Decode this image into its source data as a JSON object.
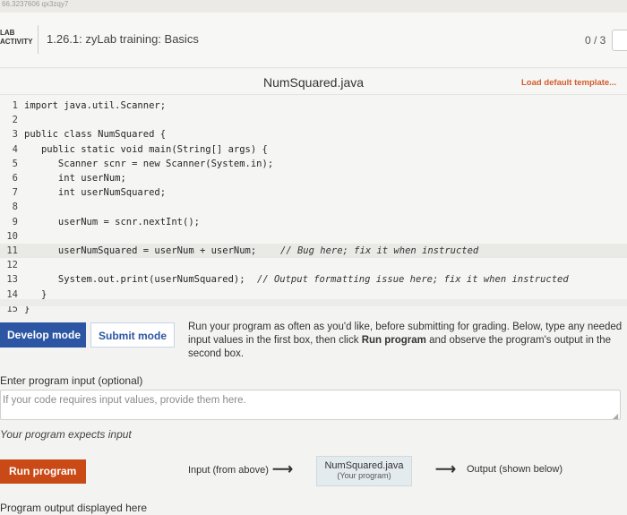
{
  "top_strip": {
    "text": "66.3237606 qx3zqy7"
  },
  "header": {
    "activity_label": "LAB\nACTIVITY",
    "title": "1.26.1: zyLab training: Basics",
    "score": "0 / 3"
  },
  "editor": {
    "file_name": "NumSquared.java",
    "load_template": "Load default template..."
  },
  "code_lines": [
    {
      "num": "1",
      "code": "import java.util.Scanner;",
      "comment": ""
    },
    {
      "num": "2",
      "code": "",
      "comment": ""
    },
    {
      "num": "3",
      "code": "public class NumSquared {",
      "comment": ""
    },
    {
      "num": "4",
      "code": "   public static void main(String[] args) {",
      "comment": ""
    },
    {
      "num": "5",
      "code": "      Scanner scnr = new Scanner(System.in);",
      "comment": ""
    },
    {
      "num": "6",
      "code": "      int userNum;",
      "comment": ""
    },
    {
      "num": "7",
      "code": "      int userNumSquared;",
      "comment": ""
    },
    {
      "num": "8",
      "code": "",
      "comment": ""
    },
    {
      "num": "9",
      "code": "      userNum = scnr.nextInt();",
      "comment": ""
    },
    {
      "num": "10",
      "code": "",
      "comment": ""
    },
    {
      "num": "11",
      "code": "      userNumSquared = userNum + userNum;",
      "comment": "// Bug here; fix it when instructed"
    },
    {
      "num": "12",
      "code": "",
      "comment": ""
    },
    {
      "num": "13",
      "code": "      System.out.print(userNumSquared);",
      "comment": "// Output formatting issue here; fix it when instructed"
    },
    {
      "num": "14",
      "code": "   }",
      "comment": ""
    },
    {
      "num": "15",
      "code": "}",
      "comment": ""
    }
  ],
  "modes": {
    "develop_label": "Develop mode",
    "submit_label": "Submit mode",
    "desc_part1": "Run your program as often as you'd like, before submitting for grading. Below, type any needed input values in the first box, then click ",
    "desc_bold": "Run program",
    "desc_part2": " and observe the program's output in the second box."
  },
  "input": {
    "label": "Enter program input (optional)",
    "placeholder": "If your code requires input values, provide them here."
  },
  "expects_text": "Your program expects input",
  "run": {
    "button_label": "Run program",
    "input_from": "Input (from above)",
    "program_name": "NumSquared.java",
    "program_sub": "(Your program)",
    "output_to": "Output (shown below)"
  },
  "output_label": "Program output displayed here"
}
